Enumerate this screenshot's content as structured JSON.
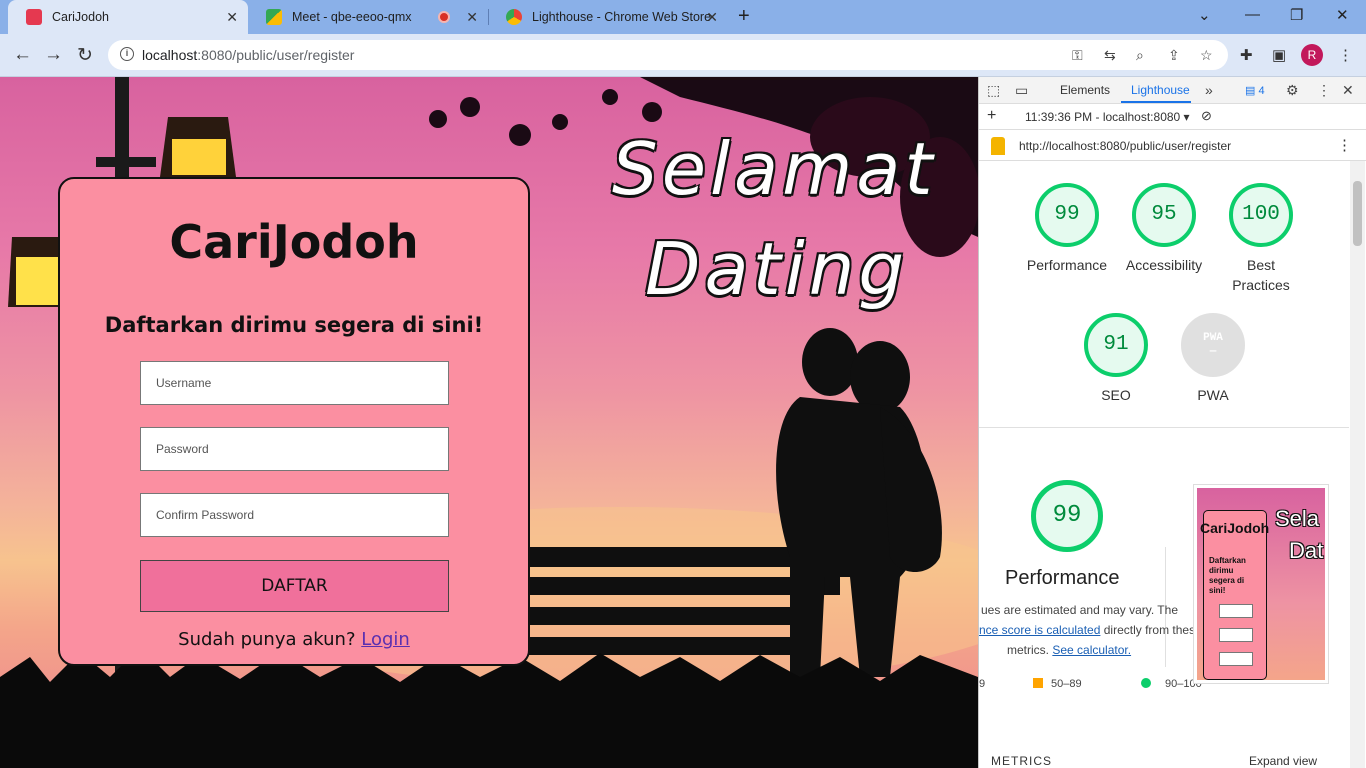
{
  "browser": {
    "tabs": [
      {
        "title": "CariJodoh",
        "active": true
      },
      {
        "title": "Meet - qbe-eeoo-qmx",
        "active": false
      },
      {
        "title": "Lighthouse - Chrome Web Store",
        "active": false
      }
    ],
    "url_host": "localhost",
    "url_path": ":8080/public/user/register",
    "avatar_letter": "R"
  },
  "page": {
    "hero_line1": "Selamat",
    "hero_line2": "Dating",
    "brand": "CariJodoh",
    "subtitle": "Daftarkan dirimu segera di sini!",
    "username_placeholder": "Username",
    "password_placeholder": "Password",
    "confirm_placeholder": "Confirm Password",
    "submit_label": "DAFTAR",
    "login_prompt": "Sudah punya akun?",
    "login_link": "Login"
  },
  "devtools": {
    "tabs": [
      "Elements",
      "Lighthouse"
    ],
    "active_tab": "Lighthouse",
    "issues_count": "4",
    "report_time": "11:39:36 PM - localhost:8080",
    "report_url": "http://localhost:8080/public/user/register",
    "scores": [
      {
        "label": "Performance",
        "value": "99"
      },
      {
        "label": "Accessibility",
        "value": "95"
      },
      {
        "label": "Best Practices",
        "value": "100"
      },
      {
        "label": "SEO",
        "value": "91"
      },
      {
        "label": "PWA",
        "value": "PWA"
      }
    ],
    "perf_score": "99",
    "perf_title": "Performance",
    "perf_text_1": "ues are estimated and may vary. The",
    "perf_link_1": "nce score is calculated",
    "perf_text_2": " directly from thes",
    "perf_text_3": "metrics. ",
    "perf_link_2": "See calculator.",
    "legend": [
      "9",
      "50–89",
      "90–100"
    ],
    "thumb_brand": "CariJodoh",
    "thumb_sub": "Daftarkan dirimu segera di sini!",
    "thumb_hero1": "Sela",
    "thumb_hero2": "Dat",
    "metrics_label": "METRICS",
    "expand_label": "Expand view",
    "colors": {
      "pass": "#0cce6b",
      "average": "#ffa400"
    }
  }
}
